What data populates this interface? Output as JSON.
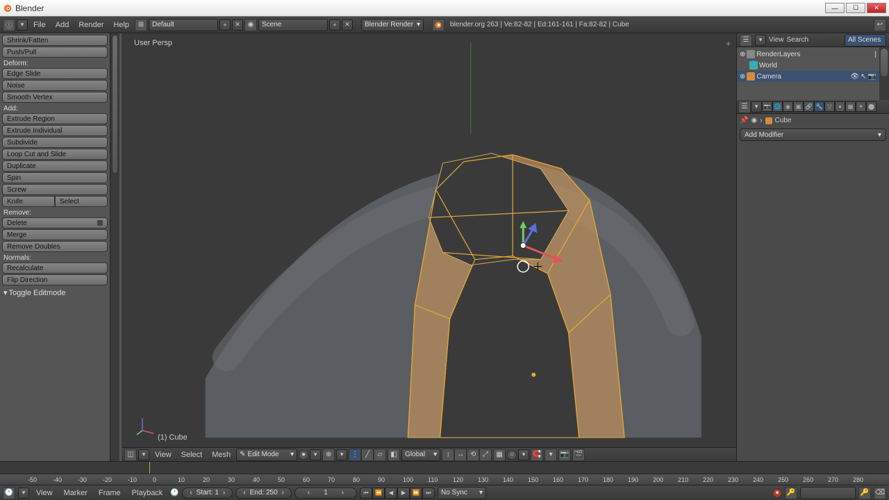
{
  "window": {
    "title": "Blender"
  },
  "header": {
    "menus": [
      "File",
      "Add",
      "Render",
      "Help"
    ],
    "layout_dropdown": "Default",
    "scene_dropdown": "Scene",
    "engine_dropdown": "Blender Render",
    "stats": "blender.org 263 | Ve:82-82 | Ed:161-161 | Fa:82-82 | Cube"
  },
  "tool_shelf": {
    "items1": [
      "Shrink/Fatten",
      "Push/Pull"
    ],
    "deform_label": "Deform:",
    "deform": [
      "Edge Slide",
      "Noise",
      "Smooth Vertex"
    ],
    "add_label": "Add:",
    "add": [
      "Extrude Region",
      "Extrude Individual",
      "Subdivide",
      "Loop Cut and Slide",
      "Duplicate",
      "Spin",
      "Screw"
    ],
    "knife": "Knife",
    "select": "Select",
    "remove_label": "Remove:",
    "delete": "Delete",
    "remove": [
      "Merge",
      "Remove Doubles"
    ],
    "normals_label": "Normals:",
    "normals": [
      "Recalculate",
      "Flip Direction"
    ],
    "toggle": "Toggle Editmode"
  },
  "viewport": {
    "persp": "User Persp",
    "object_name": "(1) Cube",
    "header_menus": [
      "View",
      "Select",
      "Mesh"
    ],
    "mode": "Edit Mode",
    "orientation": "Global"
  },
  "outliner": {
    "menus": [
      "View",
      "Search"
    ],
    "scope": "All Scenes",
    "items": [
      "RenderLayers",
      "World",
      "Camera"
    ]
  },
  "properties": {
    "object": "Cube",
    "add_modifier": "Add Modifier"
  },
  "timeline": {
    "ticks": [
      "-50",
      "-40",
      "-30",
      "-20",
      "-10",
      "0",
      "10",
      "20",
      "30",
      "40",
      "50",
      "60",
      "70",
      "80",
      "90",
      "100",
      "110",
      "120",
      "130",
      "140",
      "150",
      "160",
      "170",
      "180",
      "190",
      "200",
      "210",
      "220",
      "230",
      "240",
      "250",
      "260",
      "270",
      "280"
    ],
    "menus": [
      "View",
      "Marker",
      "Frame",
      "Playback"
    ],
    "start": "Start: 1",
    "end": "End: 250",
    "current": "1",
    "sync": "No Sync"
  }
}
